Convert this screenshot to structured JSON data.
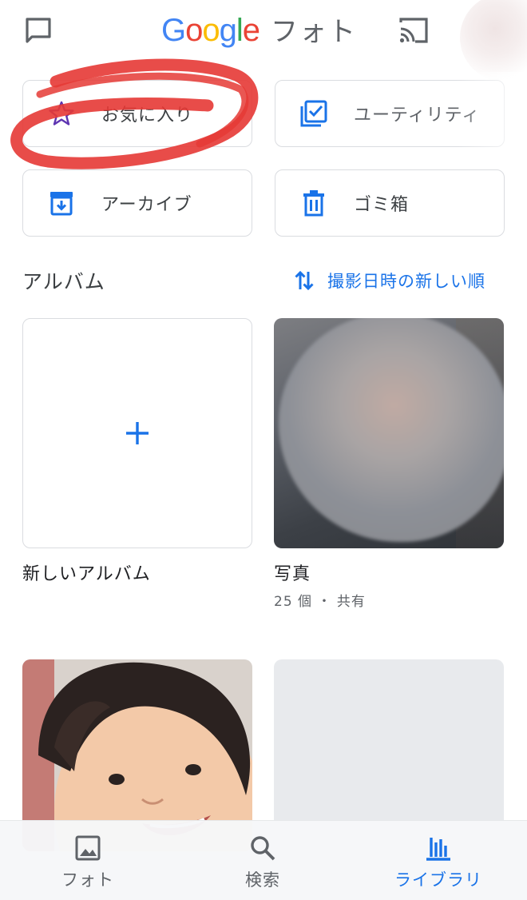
{
  "header": {
    "logo_colors": [
      {
        "ch": "G",
        "color": "#4285F4"
      },
      {
        "ch": "o",
        "color": "#EA4335"
      },
      {
        "ch": "o",
        "color": "#FBBC05"
      },
      {
        "ch": "g",
        "color": "#4285F4"
      },
      {
        "ch": "l",
        "color": "#34A853"
      },
      {
        "ch": "e",
        "color": "#EA4335"
      }
    ],
    "logo_text": "Google",
    "app_name": "フォト",
    "icons": {
      "left": "chat-bubble-icon",
      "right": "cast-icon"
    }
  },
  "utilities": [
    {
      "label": "お気に入り",
      "icon": "star-icon"
    },
    {
      "label": "ユーティリティ",
      "icon": "checklist-icon"
    },
    {
      "label": "アーカイブ",
      "icon": "archive-icon"
    },
    {
      "label": "ゴミ箱",
      "icon": "trash-icon"
    }
  ],
  "albums": {
    "title": "アルバム",
    "sort_label": "撮影日時の新しい順",
    "items": [
      {
        "name": "新しいアルバム"
      },
      {
        "name": "写真",
        "meta": "25 個 ・ 共有"
      }
    ]
  },
  "bottom_nav": {
    "items": [
      {
        "label": "フォト",
        "icon": "photo-icon"
      },
      {
        "label": "検索",
        "icon": "search-icon"
      },
      {
        "label": "ライブラリ",
        "icon": "library-icon",
        "active": true
      }
    ]
  },
  "colors": {
    "accent": "#1a73e8",
    "annotation": "#e53935",
    "border": "#dadce0",
    "text": "#3c4043"
  }
}
